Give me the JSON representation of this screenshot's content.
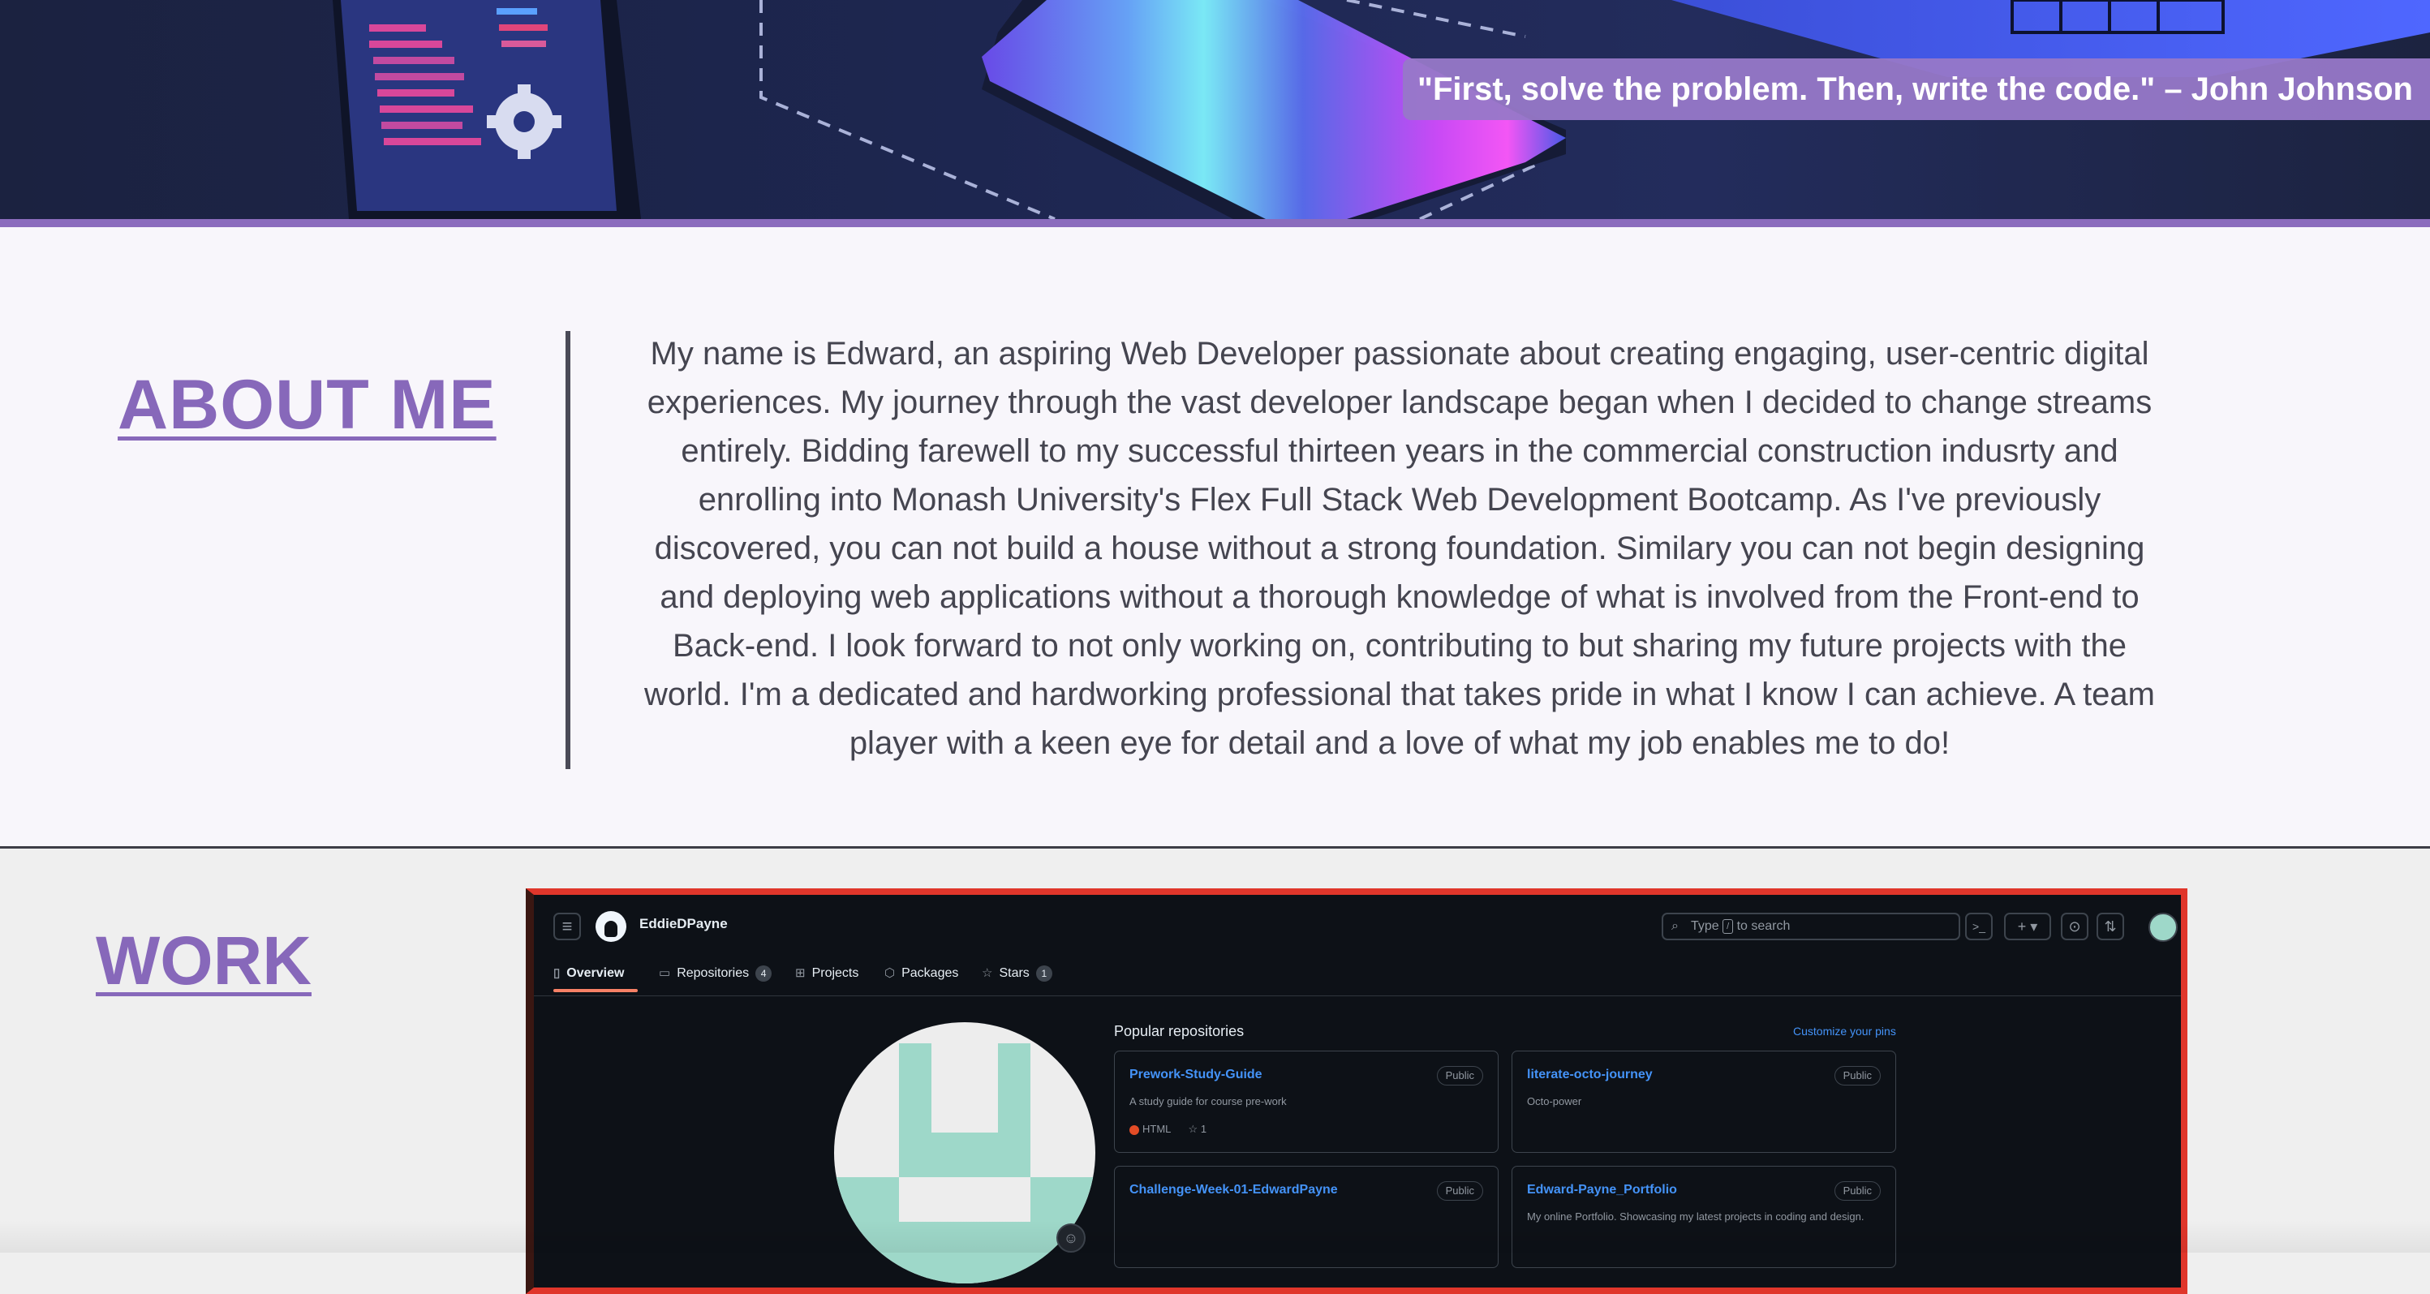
{
  "hero": {
    "quote": "\"First, solve the problem. Then, write the code.\" – John Johnson",
    "colors": {
      "accent": "#8b6cbd",
      "quote_bg": "#9778c8"
    }
  },
  "about": {
    "title": "ABOUT ME",
    "body": "My name is Edward, an aspiring Web Developer passionate about creating engaging, user-centric digital experiences. My journey through the vast developer landscape began when I decided to change streams entirely. Bidding farewell to my successful thirteen years in the commercial construction indusrty and enrolling into Monash University's Flex Full Stack Web Development Bootcamp. As I've previously discovered, you can not build a house without a strong foundation. Similary you can not begin designing and deploying web applications without a thorough knowledge of what is involved from the Front-end to Back-end. I look forward to not only working on, contributing to but sharing my future projects with the world. I'm a dedicated and hardworking professional that takes pride in what I know I can achieve. A team player with a keen eye for detail and a love of what my job enables me to do!"
  },
  "work": {
    "title": "WORK",
    "github": {
      "username": "EddieDPayne",
      "search_text_before": "Type ",
      "search_key": "/",
      "search_text_after": " to search",
      "tabs": [
        {
          "label": "Overview",
          "icon": "book-icon"
        },
        {
          "label": "Repositories",
          "icon": "repo-icon",
          "count": "4"
        },
        {
          "label": "Projects",
          "icon": "table-icon"
        },
        {
          "label": "Packages",
          "icon": "package-icon"
        },
        {
          "label": "Stars",
          "icon": "star-icon",
          "count": "1"
        }
      ],
      "popular_title": "Popular repositories",
      "customize_link": "Customize your pins",
      "repos": [
        {
          "name": "Prework-Study-Guide",
          "badge": "Public",
          "description": "A study guide for course pre-work",
          "language": "HTML",
          "stars": "1"
        },
        {
          "name": "literate-octo-journey",
          "badge": "Public",
          "description": "Octo-power"
        },
        {
          "name": "Challenge-Week-01-EdwardPayne",
          "badge": "Public",
          "description": ""
        },
        {
          "name": "Edward-Payne_Portfolio",
          "badge": "Public",
          "description": "My online Portfolio. Showcasing my latest projects in coding and design."
        }
      ]
    }
  }
}
